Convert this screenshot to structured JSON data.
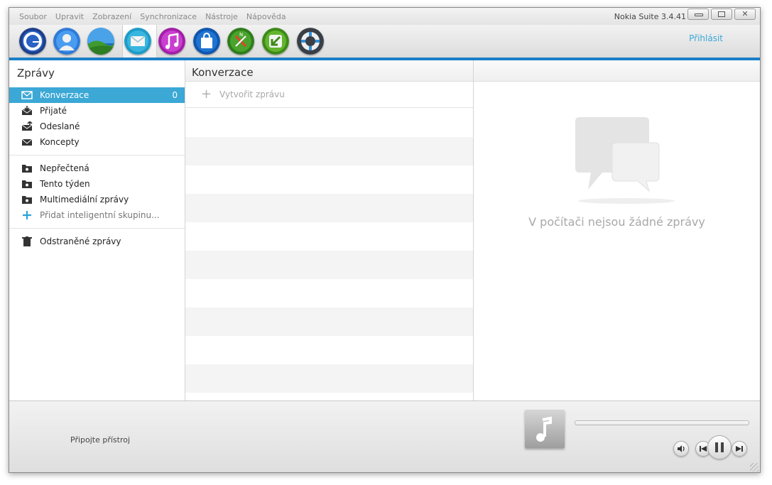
{
  "menu": {
    "items": [
      "Soubor",
      "Upravit",
      "Zobrazení",
      "Synchronizace",
      "Nástroje",
      "Nápověda"
    ]
  },
  "window": {
    "title": "Nokia Suite 3.4.41"
  },
  "toolbar": {
    "icons": [
      "home-icon",
      "contacts-icon",
      "photos-icon",
      "messages-icon",
      "music-icon",
      "store-icon",
      "maps-icon",
      "sync-icon",
      "support-icon"
    ],
    "active": "messages-icon",
    "signin_label": "Přihlásit"
  },
  "sidebar": {
    "title": "Zprávy",
    "folders": [
      {
        "label": "Konverzace",
        "count": "0",
        "icon": "conversation-icon",
        "selected": true
      },
      {
        "label": "Přijaté",
        "icon": "inbox-icon"
      },
      {
        "label": "Odeslané",
        "icon": "sent-icon"
      },
      {
        "label": "Koncepty",
        "icon": "drafts-icon"
      }
    ],
    "smart_groups": [
      {
        "label": "Nepřečtená",
        "icon": "smart-folder-icon"
      },
      {
        "label": "Tento týden",
        "icon": "smart-folder-icon"
      },
      {
        "label": "Multimediální zprávy",
        "icon": "smart-folder-icon"
      }
    ],
    "add_group_label": "Přidat inteligentní skupinu...",
    "deleted_label": "Odstraněné zprávy"
  },
  "conversations": {
    "title": "Konverzace",
    "new_message_label": "Vytvořit zprávu"
  },
  "detail": {
    "empty_text": "V počítači nejsou žádné zprávy"
  },
  "footer": {
    "connect_label": "Připojte přístroj",
    "player": {
      "progress": 0,
      "state": "paused"
    }
  },
  "colors": {
    "accent": "#3ba8d6",
    "brand_bar": "#1a7fc7"
  }
}
